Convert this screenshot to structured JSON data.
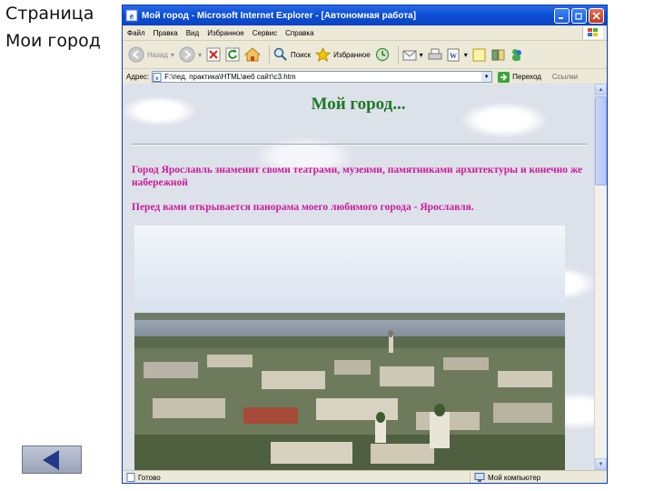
{
  "slide": {
    "title_line1": "Страница",
    "title_line2": "Мои город",
    "back_button": "back-arrow-icon"
  },
  "browser": {
    "window_title": "Мой город - Microsoft Internet Explorer - [Автономная работа]",
    "menu": [
      "Файл",
      "Правка",
      "Вид",
      "Избранное",
      "Сервис",
      "Справка"
    ],
    "toolbar": {
      "back": "Назад",
      "search": "Поиск",
      "favorites": "Избранное"
    },
    "address": {
      "label": "Адрес:",
      "value": "F:\\пед. практика\\HTML\\веб сайт\\с3.htm",
      "go": "Переход",
      "links": "Ссылки"
    },
    "status": {
      "left": "Готово",
      "right": "Мой компьютер"
    }
  },
  "page": {
    "heading": "Мой город...",
    "paragraph1": "Город Ярославль знаменит своми театрами, музеями, памятниками архитектуры и конечно же набережной",
    "paragraph2": "Перед вами открывается панорама моего любимого города - Ярославля."
  },
  "colors": {
    "heading": "#1b7a24",
    "paragraph": "#cc1a9a",
    "titlebar": "#0d4fd6"
  }
}
